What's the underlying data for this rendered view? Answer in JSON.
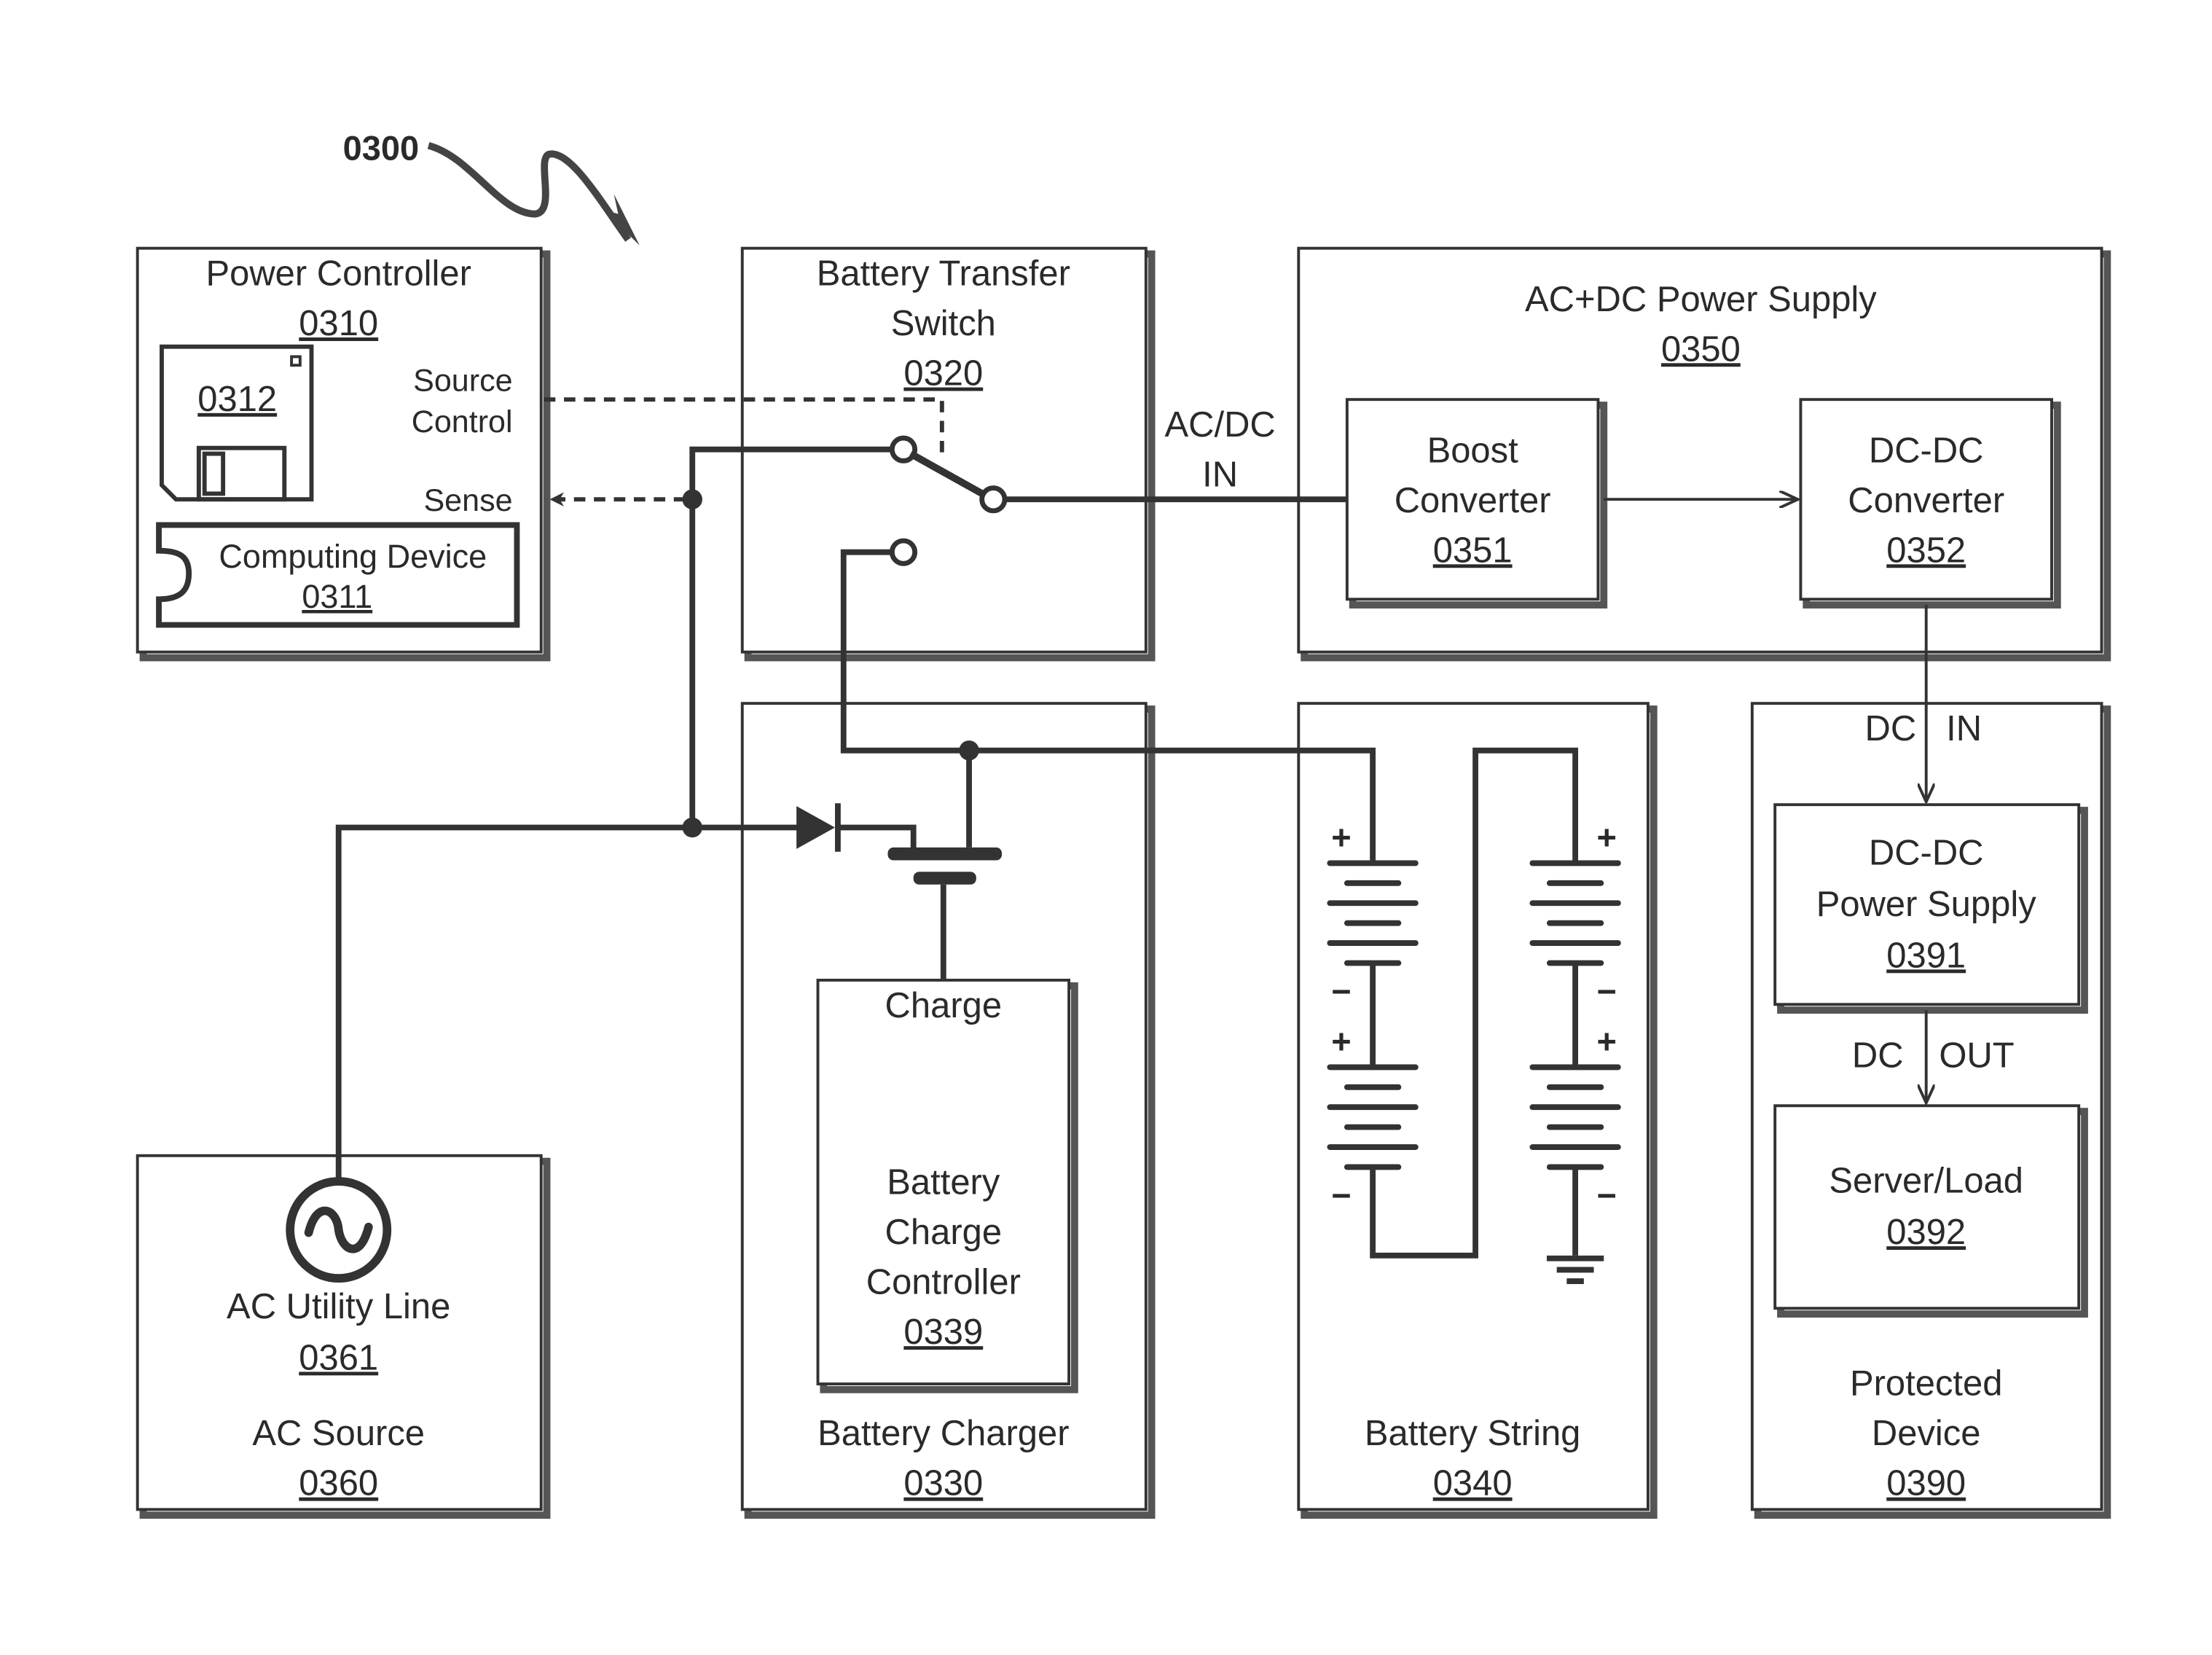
{
  "figure": {
    "reference": "0300"
  },
  "power_controller": {
    "title": "Power Controller",
    "ref": "0310",
    "storage_ref": "0312",
    "source_control_line1": "Source",
    "source_control_line2": "Control",
    "sense_label": "Sense",
    "computing_device_label": "Computing Device",
    "computing_device_ref": "0311"
  },
  "battery_transfer_switch": {
    "title_line1": "Battery Transfer",
    "title_line2": "Switch",
    "ref": "0320"
  },
  "ac_dc_in": {
    "line1": "AC/DC",
    "line2": "IN"
  },
  "ac_dc_power_supply": {
    "title": "AC+DC Power Supply",
    "ref": "0350",
    "boost_converter_line1": "Boost",
    "boost_converter_line2": "Converter",
    "boost_converter_ref": "0351",
    "dcdc_converter_line1": "DC-DC",
    "dcdc_converter_line2": "Converter",
    "dcdc_converter_ref": "0352"
  },
  "battery_charger": {
    "title": "Battery Charger",
    "ref": "0330",
    "charge_label": "Charge",
    "controller_line1": "Battery",
    "controller_line2": "Charge",
    "controller_line3": "Controller",
    "controller_ref": "0339"
  },
  "battery_string": {
    "title": "Battery String",
    "ref": "0340",
    "plus": "+",
    "minus": "−"
  },
  "protected_device": {
    "title_line1": "Protected",
    "title_line2": "Device",
    "ref": "0390",
    "dc_in_a": "DC",
    "dc_in_b": "IN",
    "dc_out_a": "DC",
    "dc_out_b": "OUT",
    "dcdc_ps_line1": "DC-DC",
    "dcdc_ps_line2": "Power Supply",
    "dcdc_ps_ref": "0391",
    "server_label": "Server/Load",
    "server_ref": "0392"
  },
  "ac_source": {
    "utility_label": "AC Utility Line",
    "utility_ref": "0361",
    "title": "AC Source",
    "ref": "0360"
  }
}
